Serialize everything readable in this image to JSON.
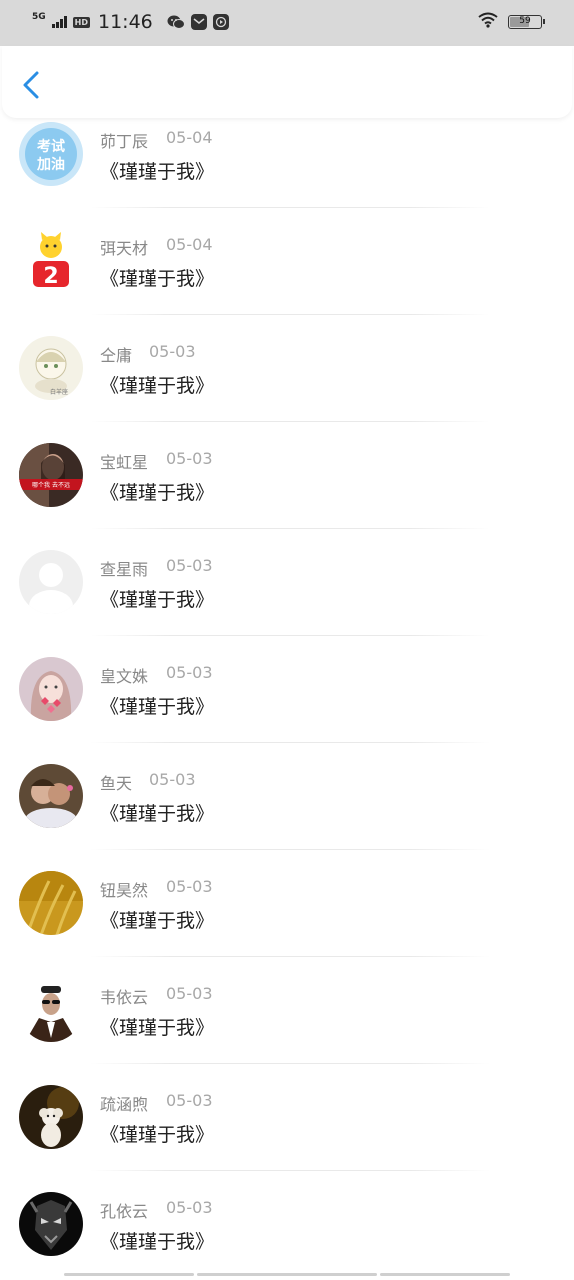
{
  "status_bar": {
    "network": "5G",
    "hd": "HD",
    "time": "11:46",
    "battery": "59"
  },
  "header": {
    "back_icon": "chevron-left-icon",
    "accent_color": "#2a8ee4"
  },
  "items": [
    {
      "name": "茆丁辰",
      "date": "05-04",
      "title": "《瑾瑾于我》",
      "avatar": "blue-text-badge"
    },
    {
      "name": "弭天材",
      "date": "05-04",
      "title": "《瑾瑾于我》",
      "avatar": "cartoon-cat-number"
    },
    {
      "name": "仝庸",
      "date": "05-03",
      "title": "《瑾瑾于我》",
      "avatar": "cartoon-girl"
    },
    {
      "name": "宝虹星",
      "date": "05-03",
      "title": "《瑾瑾于我》",
      "avatar": "woman-portrait-red"
    },
    {
      "name": "查星雨",
      "date": "05-03",
      "title": "《瑾瑾于我》",
      "avatar": "default-person"
    },
    {
      "name": "皇文姝",
      "date": "05-03",
      "title": "《瑾瑾于我》",
      "avatar": "girl-hearts"
    },
    {
      "name": "鱼天",
      "date": "05-03",
      "title": "《瑾瑾于我》",
      "avatar": "children-hug"
    },
    {
      "name": "钮昊然",
      "date": "05-03",
      "title": "《瑾瑾于我》",
      "avatar": "golden-wheat"
    },
    {
      "name": "韦依云",
      "date": "05-03",
      "title": "《瑾瑾于我》",
      "avatar": "man-sunglasses"
    },
    {
      "name": "疏涵煦",
      "date": "05-03",
      "title": "《瑾瑾于我》",
      "avatar": "white-puppy"
    },
    {
      "name": "孔依云",
      "date": "05-03",
      "title": "《瑾瑾于我》",
      "avatar": "dark-mask"
    }
  ]
}
